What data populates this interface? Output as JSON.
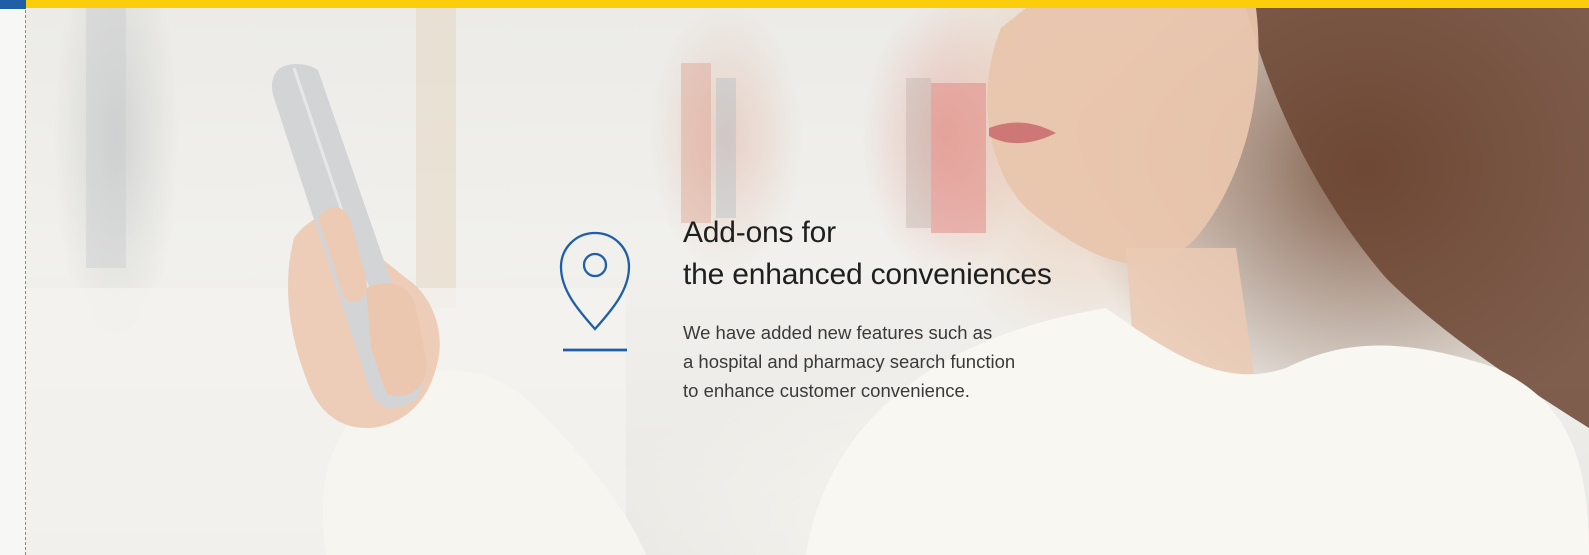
{
  "hero": {
    "title_line1": "Add-ons for",
    "title_line2": "the enhanced conveniences",
    "desc_line1": "We have added new features such as",
    "desc_line2": "a hospital and pharmacy search function",
    "desc_line3": "to enhance customer convenience.",
    "icon": "map-pin-icon"
  },
  "colors": {
    "accent_yellow": "#fccd0b",
    "accent_blue": "#1f5fa8"
  }
}
